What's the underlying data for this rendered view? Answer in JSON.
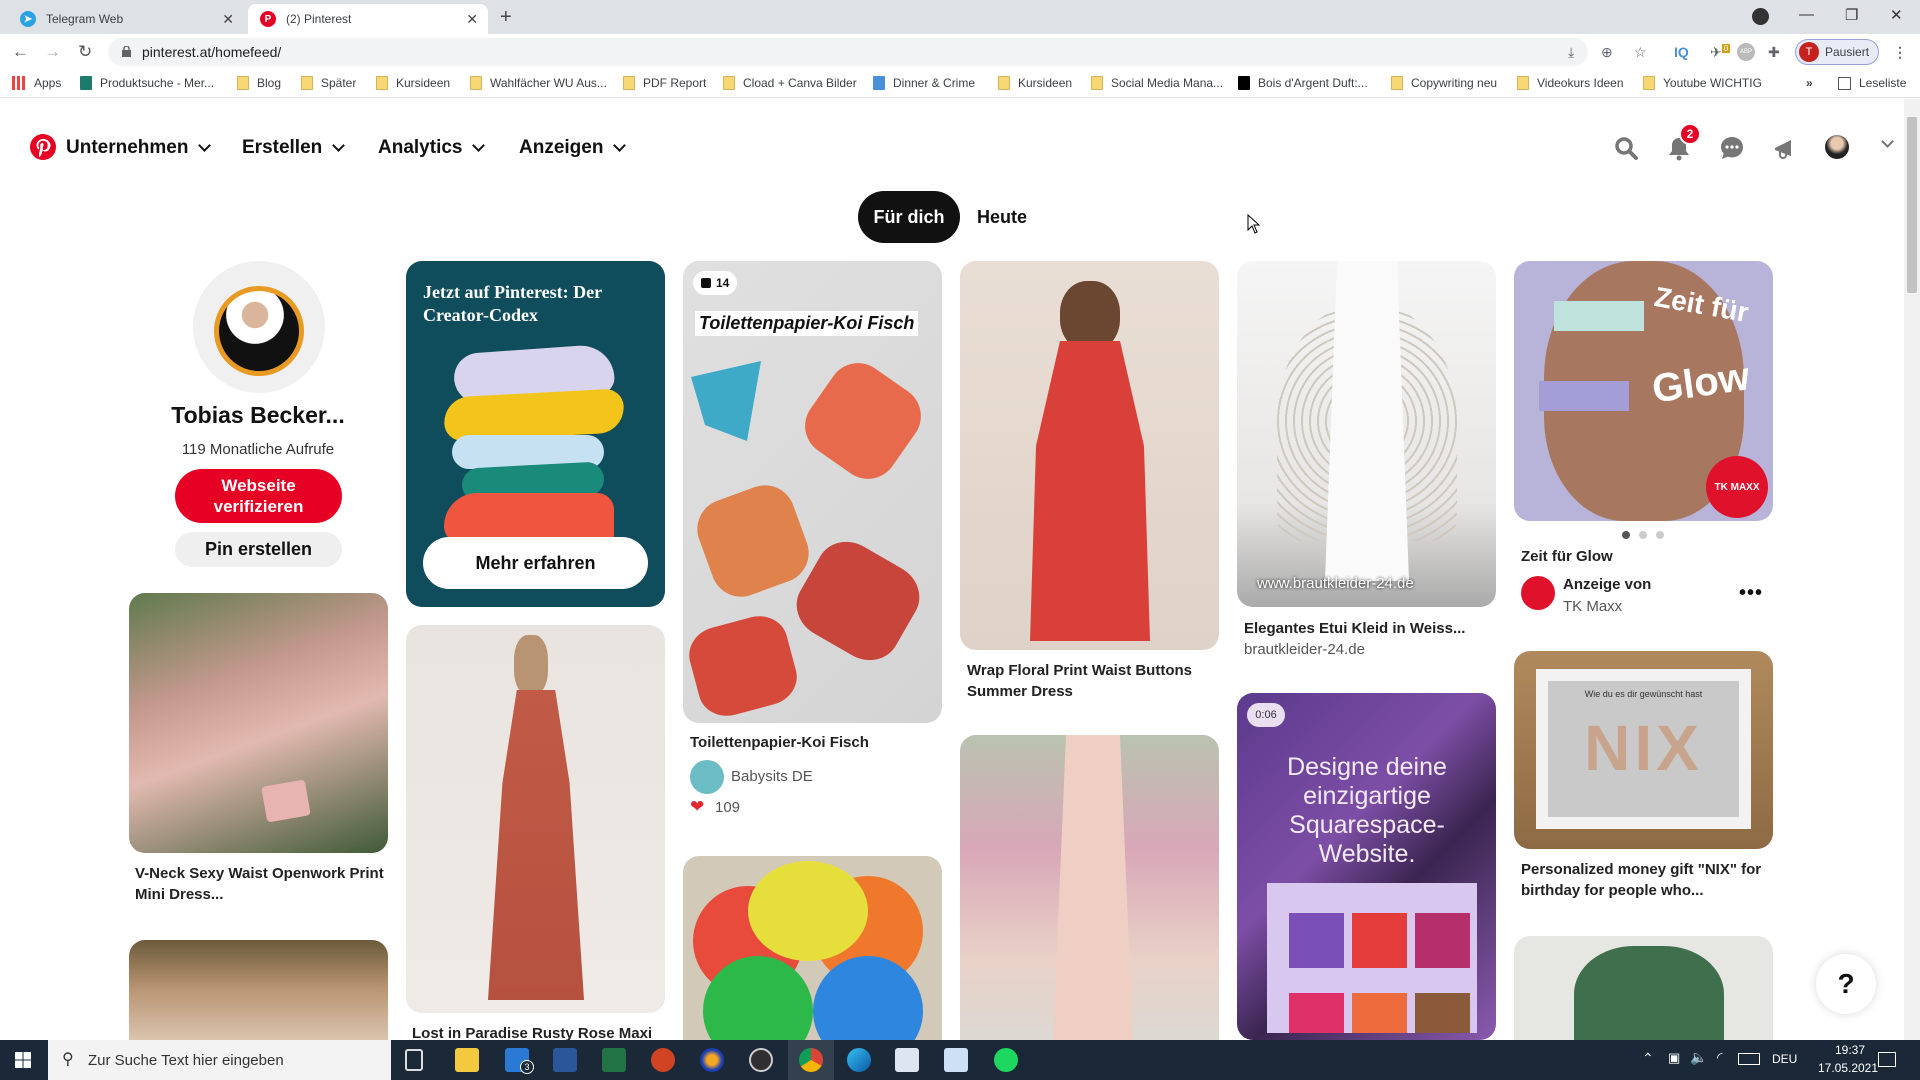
{
  "browser": {
    "tabs": [
      {
        "title": "Telegram Web",
        "icon": "telegram-icon",
        "active": false
      },
      {
        "title": "(2) Pinterest",
        "icon": "pinterest-icon",
        "active": true
      }
    ],
    "new_tab": "+",
    "url": "pinterest.at/homefeed/",
    "profile": {
      "initial": "T",
      "label": "Pausiert"
    },
    "extension_badges": {
      "iq": "IQ",
      "counter": "0",
      "abp": "ABP"
    },
    "bookmarks": [
      {
        "label": "Apps",
        "icon": "apps-grid-icon"
      },
      {
        "label": "Produktsuche - Mer...",
        "icon": "site-icon"
      },
      {
        "label": "Blog",
        "icon": "folder-icon"
      },
      {
        "label": "Später",
        "icon": "folder-icon"
      },
      {
        "label": "Kursideen",
        "icon": "folder-icon"
      },
      {
        "label": "Wahlfächer WU Aus...",
        "icon": "folder-icon"
      },
      {
        "label": "PDF Report",
        "icon": "folder-icon"
      },
      {
        "label": "Cload + Canva Bilder",
        "icon": "folder-icon"
      },
      {
        "label": "Dinner & Crime",
        "icon": "site-icon"
      },
      {
        "label": "Kursideen",
        "icon": "folder-icon"
      },
      {
        "label": "Social Media Mana...",
        "icon": "folder-icon"
      },
      {
        "label": "Bois d'Argent Duft:...",
        "icon": "site-icon"
      },
      {
        "label": "Copywriting neu",
        "icon": "folder-icon"
      },
      {
        "label": "Videokurs Ideen",
        "icon": "folder-icon"
      },
      {
        "label": "Youtube WICHTIG",
        "icon": "folder-icon"
      }
    ],
    "more_bookmarks": "»",
    "reading_list": "Leseliste"
  },
  "header": {
    "nav": [
      "Unternehmen",
      "Erstellen",
      "Analytics",
      "Anzeigen"
    ],
    "notification_count": "2",
    "accent": "#e60023"
  },
  "feed_tabs": [
    {
      "label": "Für dich",
      "active": true
    },
    {
      "label": "Heute",
      "active": false
    }
  ],
  "profile_card": {
    "name": "Tobias Becker...",
    "stats": "119 Monatliche Aufrufe",
    "verify_button": "Webseite verifizieren",
    "create_pin_button": "Pin erstellen"
  },
  "pins": {
    "creator_codex": {
      "title": "Jetzt auf Pinterest: Der Creator-Codex",
      "button": "Mehr erfahren"
    },
    "koi": {
      "overlay_title": "Toilettenpapier-Koi Fisch",
      "count": "14",
      "title": "Toilettenpapier-Koi Fisch",
      "author": "Babysits DE",
      "reactions": "109"
    },
    "wrap_dress": {
      "title": "Wrap Floral Print Waist Buttons Summer Dress"
    },
    "etui": {
      "title": "Elegantes Etui Kleid in Weiss...",
      "source": "brautkleider-24.de",
      "watermark": "www.brautkleider-24.de"
    },
    "glow": {
      "overlay_1": "Zeit für",
      "overlay_2": "Glow",
      "title": "Zeit für Glow",
      "sponsor_label": "Anzeige von",
      "sponsor": "TK Maxx",
      "brand": "TK MAXX",
      "carousel_pages": 3,
      "carousel_active": 1
    },
    "vneck": {
      "title": "V-Neck Sexy Waist Openwork Print Mini Dress..."
    },
    "rusty": {
      "title": "Lost in Paradise Rusty Rose Maxi"
    },
    "squarespace": {
      "duration": "0:06",
      "overlay": "Designe deine einzigartige Squarespace-Website."
    },
    "nix": {
      "overlay": "Wie du es dir gewünscht hast",
      "title": "Personalized money gift \"NIX\" for birthday for people who..."
    }
  },
  "help_button": "?",
  "taskbar": {
    "search_placeholder": "Zur Suche Text hier eingeben",
    "mail_badge": "3",
    "language": "DEU",
    "time": "19:37",
    "date": "17.05.2021"
  }
}
